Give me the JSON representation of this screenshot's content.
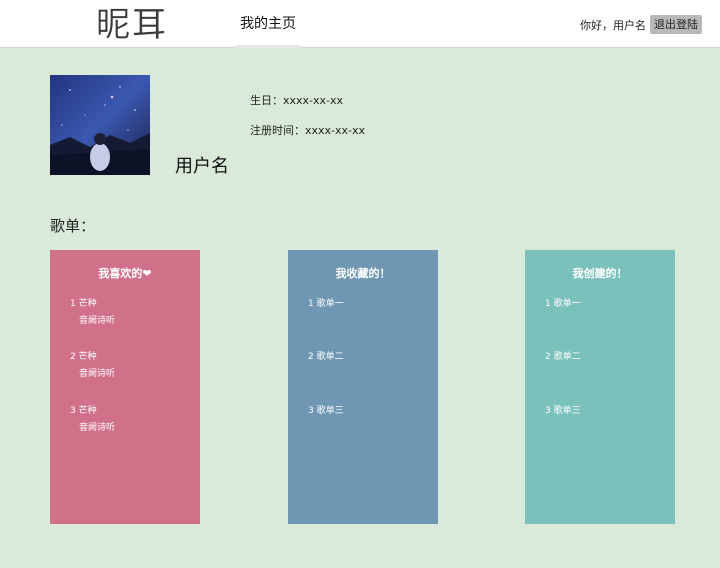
{
  "header": {
    "logo_text": "昵耳",
    "nav_tab": "我的主页",
    "greeting": "你好，用户名",
    "logout_label": "退出登陆"
  },
  "profile": {
    "username": "用户名",
    "birthday": "生日：xxxx-xx-xx",
    "register_time": "注册时间：xxxx-xx-xx"
  },
  "playlists": {
    "section_label": "歌单：",
    "cards": [
      {
        "title": "我喜欢的❤",
        "color": "#d07189",
        "items": [
          {
            "title": "1 芒种",
            "artist": "音阙诗听"
          },
          {
            "title": "2 芒种",
            "artist": "音阙诗听"
          },
          {
            "title": "3 芒种",
            "artist": "音阙诗听"
          }
        ]
      },
      {
        "title": "我收藏的！",
        "color": "#6f96b3",
        "items": [
          {
            "title": "1 歌单一"
          },
          {
            "title": "2 歌单二"
          },
          {
            "title": "3 歌单三"
          }
        ]
      },
      {
        "title": "我创建的！",
        "color": "#7bc1bb",
        "items": [
          {
            "title": "1 歌单一"
          },
          {
            "title": "2 歌单二"
          },
          {
            "title": "3 歌单三"
          }
        ]
      }
    ]
  },
  "colors": {
    "page_background": "#d9ebd8",
    "topbar_background": "#ffffff",
    "logout_button": "#b9b9b9"
  }
}
